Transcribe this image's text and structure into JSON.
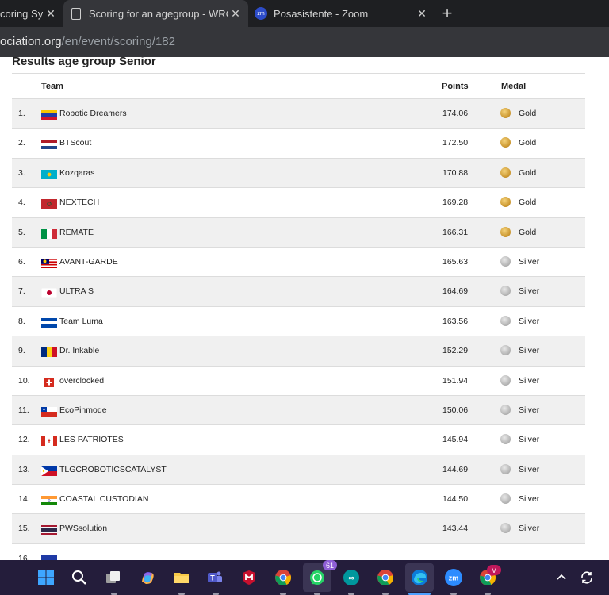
{
  "browser": {
    "tabs": [
      {
        "title": "coring Sys",
        "icon": "partial-tab"
      },
      {
        "title": "Scoring for an agegroup - WRO S",
        "icon": "document-icon",
        "active": true
      },
      {
        "title": "Posasistente - Zoom",
        "icon": "zoom-icon",
        "favicon_text": "zm"
      }
    ],
    "close_glyph": "✕",
    "new_tab_glyph": "+",
    "url_host": "ociation.org",
    "url_path": "/en/event/scoring/182"
  },
  "page": {
    "heading": "Results age group Senior",
    "columns": {
      "team": "Team",
      "points": "Points",
      "medal": "Medal"
    },
    "rows": [
      {
        "rank": "1.",
        "team": "Robotic Dreamers",
        "flag": "venezuela",
        "points": "174.06",
        "medal": "Gold"
      },
      {
        "rank": "2.",
        "team": "BTScout",
        "flag": "netherlands",
        "points": "172.50",
        "medal": "Gold"
      },
      {
        "rank": "3.",
        "team": "Kozqaras",
        "flag": "kazakhstan",
        "points": "170.88",
        "medal": "Gold"
      },
      {
        "rank": "4.",
        "team": "NEXTECH",
        "flag": "morocco",
        "points": "169.28",
        "medal": "Gold"
      },
      {
        "rank": "5.",
        "team": "REMATE",
        "flag": "italy",
        "points": "166.31",
        "medal": "Gold"
      },
      {
        "rank": "6.",
        "team": "AVANT-GARDE",
        "flag": "malaysia",
        "points": "165.63",
        "medal": "Silver"
      },
      {
        "rank": "7.",
        "team": "ULTRA S",
        "flag": "japan",
        "points": "164.69",
        "medal": "Silver"
      },
      {
        "rank": "8.",
        "team": "Team Luma",
        "flag": "el-salvador",
        "points": "163.56",
        "medal": "Silver"
      },
      {
        "rank": "9.",
        "team": "Dr. Inkable",
        "flag": "romania",
        "points": "152.29",
        "medal": "Silver"
      },
      {
        "rank": "10.",
        "team": "overclocked",
        "flag": "switzerland",
        "points": "151.94",
        "medal": "Silver"
      },
      {
        "rank": "11.",
        "team": "EcoPinmode",
        "flag": "chile",
        "points": "150.06",
        "medal": "Silver"
      },
      {
        "rank": "12.",
        "team": "LES PATRIOTES",
        "flag": "canada",
        "points": "145.94",
        "medal": "Silver"
      },
      {
        "rank": "13.",
        "team": "TLGCROBOTICSCATALYST",
        "flag": "philippines",
        "points": "144.69",
        "medal": "Silver"
      },
      {
        "rank": "14.",
        "team": "COASTAL CUSTODIAN",
        "flag": "india",
        "points": "144.50",
        "medal": "Silver"
      },
      {
        "rank": "15.",
        "team": "PWSsolution",
        "flag": "thailand",
        "points": "143.44",
        "medal": "Silver"
      },
      {
        "rank": "16.",
        "team": "",
        "flag": "partial",
        "points": "",
        "medal": ""
      }
    ]
  },
  "taskbar": {
    "items": [
      {
        "name": "start-button",
        "icon": "windows-logo-icon"
      },
      {
        "name": "search-button",
        "icon": "search-icon"
      },
      {
        "name": "task-view-button",
        "icon": "task-view-icon"
      },
      {
        "name": "copilot-button",
        "icon": "copilot-icon"
      },
      {
        "name": "file-explorer-button",
        "icon": "folder-icon"
      },
      {
        "name": "teams-button",
        "icon": "teams-icon"
      },
      {
        "name": "mcafee-button",
        "icon": "mcafee-icon"
      },
      {
        "name": "chrome-profile-1-button",
        "icon": "chrome-icon"
      },
      {
        "name": "whatsapp-button",
        "icon": "whatsapp-icon",
        "badge": "61"
      },
      {
        "name": "arduino-button",
        "icon": "arduino-icon"
      },
      {
        "name": "chrome-profile-2-button",
        "icon": "chrome-icon"
      },
      {
        "name": "edge-button",
        "icon": "edge-icon"
      },
      {
        "name": "zoom-button",
        "icon": "zoom-icon",
        "label": "zm"
      },
      {
        "name": "chrome-profile-3-button",
        "icon": "chrome-icon",
        "badge": "V"
      }
    ],
    "tray": {
      "overflow_icon": "chevron-up-icon",
      "sync_icon": "sync-icon"
    }
  },
  "colors": {
    "gold": "#c9942c",
    "silver": "#b0b0b0",
    "tab_bar": "#1e1f22",
    "taskbar": "#241d3b"
  }
}
